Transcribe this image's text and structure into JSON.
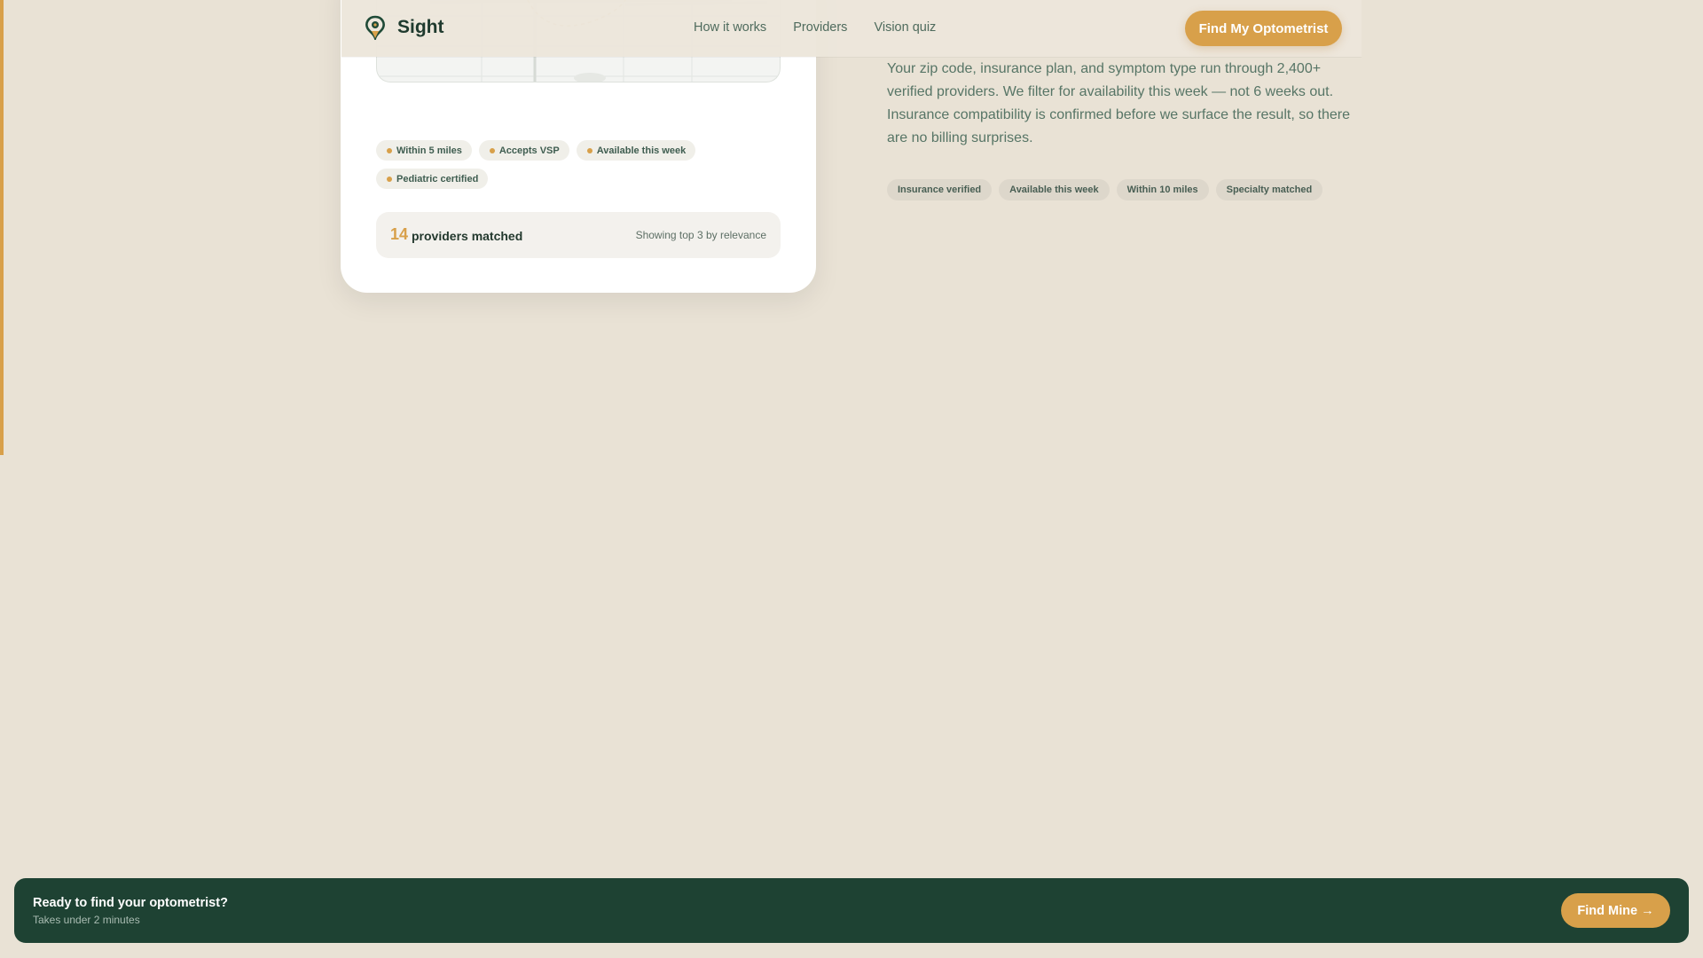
{
  "header": {
    "brand": "Sight",
    "nav": [
      {
        "label": "How it works"
      },
      {
        "label": "Providers"
      },
      {
        "label": "Vision quiz"
      }
    ],
    "cta_label": "Find My Optometrist"
  },
  "card": {
    "filters": [
      "Within 5 miles",
      "Accepts VSP",
      "Available this week",
      "Pediatric certified"
    ],
    "match": {
      "count": "14",
      "label": "providers matched",
      "note": "Showing top 3 by relevance"
    }
  },
  "info": {
    "description": "Your zip code, insurance plan, and symptom type run through 2,400+ verified providers. We filter for availability this week — not 6 weeks out. Insurance compatibility is confirmed before we surface the result, so there are no billing surprises.",
    "tags": [
      "Insurance verified",
      "Available this week",
      "Within 10 miles",
      "Specialty matched"
    ]
  },
  "bottom_bar": {
    "title": "Ready to find your optometrist?",
    "subtitle": "Takes under 2 minutes",
    "button_label": "Find Mine →"
  },
  "colors": {
    "background": "#e9e2d5",
    "accent": "#d8a04a",
    "dark_green": "#1e4233"
  }
}
